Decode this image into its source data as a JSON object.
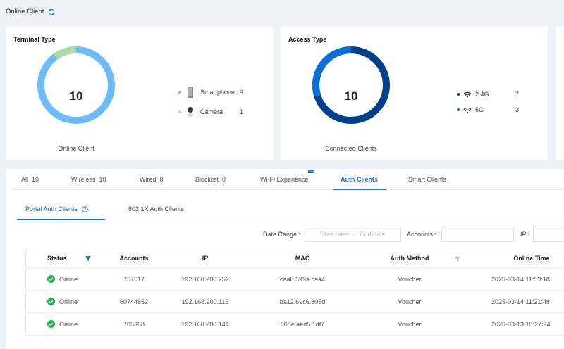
{
  "header": {
    "title": "Online Client",
    "refresh_icon": "refresh-icon"
  },
  "terminal_type": {
    "title": "Terminal Type",
    "total": "10",
    "caption": "Online Client",
    "items": [
      {
        "label": "Smartphone",
        "count": "9",
        "color": "#6bbcf8",
        "icon": "smartphone-icon"
      },
      {
        "label": "Camera",
        "count": "1",
        "color": "#a8dca8",
        "icon": "camera-icon"
      }
    ]
  },
  "access_type": {
    "title": "Access Type",
    "total": "10",
    "caption": "Connected Clients",
    "items": [
      {
        "label": "2.4G",
        "count": "7",
        "color": "#003f8a",
        "icon": "wifi-icon"
      },
      {
        "label": "5G",
        "count": "3",
        "color": "#0a6fd8",
        "icon": "wifi-icon"
      }
    ]
  },
  "tabs": [
    {
      "label": "All",
      "count": "10"
    },
    {
      "label": "Wireless",
      "count": "10"
    },
    {
      "label": "Wired",
      "count": "0"
    },
    {
      "label": "Blocklist",
      "count": "0"
    },
    {
      "label": "Wi-Fi Experience",
      "count": "",
      "badge": "new"
    },
    {
      "label": "Auth Clients",
      "count": "",
      "active": true
    },
    {
      "label": "Smart Clients",
      "count": ""
    }
  ],
  "subtabs": [
    {
      "label": "Portal Auth Clients",
      "active": true
    },
    {
      "label": "802.1X Auth Clients"
    }
  ],
  "filters": {
    "date_label": "Date Range :",
    "start_placeholder": "Start date",
    "sep": "~",
    "end_placeholder": "End date",
    "accounts_label": "Accounts :",
    "ip_label": "IP :"
  },
  "table": {
    "columns": [
      "Status",
      "Accounts",
      "IP",
      "MAC",
      "Auth Method",
      "Online Time"
    ],
    "rows": [
      {
        "status": "Online",
        "account": "757517",
        "ip": "192.168.200.252",
        "mac": "caa8.599a.caa4",
        "method": "Voucher",
        "time": "2025-03-14 11:59:18"
      },
      {
        "status": "Online",
        "account": "60744852",
        "ip": "192.168.200.113",
        "mac": "ba12.69c6.805d",
        "method": "Voucher",
        "time": "2025-03-14 11:21:48"
      },
      {
        "status": "Online",
        "account": "705368",
        "ip": "192.168.200.144",
        "mac": "665e.aed5.1df7",
        "method": "Voucher",
        "time": "2025-03-13 15:27:24"
      }
    ]
  },
  "colors": {
    "accent": "#1a6ed8",
    "online": "#27b14a"
  }
}
